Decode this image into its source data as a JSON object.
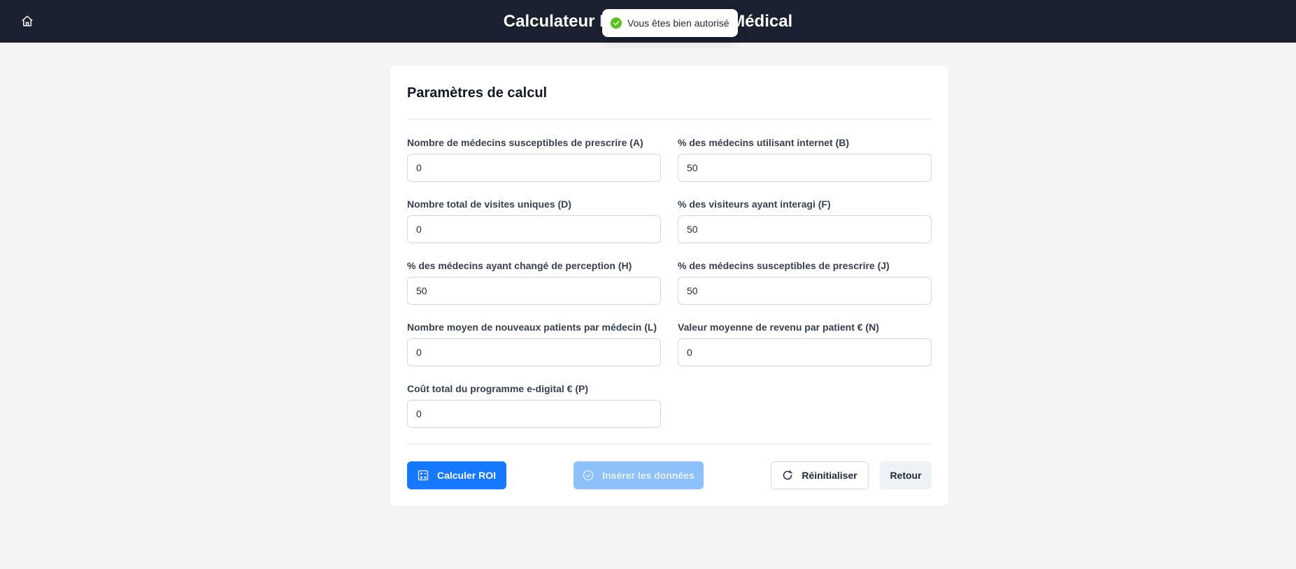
{
  "header": {
    "title": "Calculateur ROI Laboratoire Médical",
    "home_icon": "home-icon"
  },
  "toast": {
    "message": "Vous êtes bien autorisé",
    "icon": "check-circle-icon",
    "color": "#52c41a"
  },
  "card": {
    "title": "Paramètres de calcul"
  },
  "fields": {
    "a": {
      "label": "Nombre de médecins susceptibles de prescrire (A)",
      "value": "0"
    },
    "b": {
      "label": "% des médecins utilisant internet (B)",
      "value": "50"
    },
    "d": {
      "label": "Nombre total de visites uniques (D)",
      "value": "0"
    },
    "f": {
      "label": "% des visiteurs ayant interagi (F)",
      "value": "50"
    },
    "h": {
      "label": "% des médecins ayant changé de perception (H)",
      "value": "50"
    },
    "j": {
      "label": "% des médecins susceptibles de prescrire (J)",
      "value": "50"
    },
    "l": {
      "label": "Nombre moyen de nouveaux patients par médecin (L)",
      "value": "0"
    },
    "n": {
      "label": "Valeur moyenne de revenu par patient € (N)",
      "value": "0"
    },
    "p": {
      "label": "Coût total du programme e-digital € (P)",
      "value": "0"
    }
  },
  "actions": {
    "calculate": {
      "label": "Calculer ROI",
      "icon": "calculator-icon"
    },
    "insert": {
      "label": "Insérer les données",
      "icon": "check-circle-icon",
      "disabled": true
    },
    "reset": {
      "label": "Réinitialiser",
      "icon": "reload-icon"
    },
    "back": {
      "label": "Retour"
    }
  },
  "colors": {
    "header_bg": "#1b2130",
    "primary": "#1677ff",
    "primary_disabled": "#8ec1fb",
    "page_bg": "#f4f4f5"
  }
}
